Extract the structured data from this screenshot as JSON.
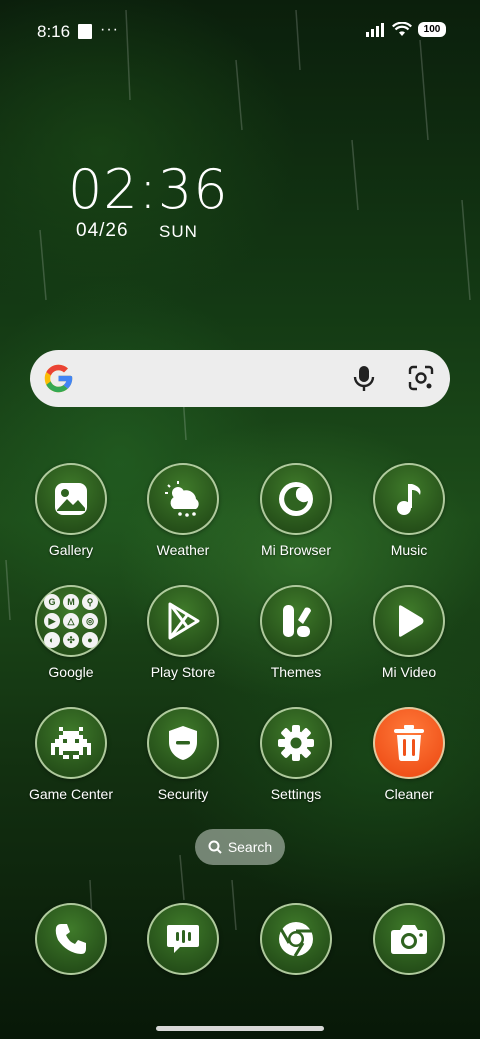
{
  "status_bar": {
    "time": "8:16",
    "dots": "···",
    "battery": "100"
  },
  "clock": {
    "time": "02:36",
    "date": "04/26",
    "day": "SUN"
  },
  "search_widget": {
    "brand": "Google",
    "colors": {
      "blue": "#4285F4",
      "red": "#EA4335",
      "yellow": "#FBBC05",
      "green": "#34A853"
    }
  },
  "apps": [
    {
      "label": "Gallery",
      "icon": "gallery-icon"
    },
    {
      "label": "Weather",
      "icon": "weather-icon"
    },
    {
      "label": "Mi Browser",
      "icon": "browser-icon"
    },
    {
      "label": "Music",
      "icon": "music-icon"
    },
    {
      "label": "Google",
      "icon": "google-folder-icon"
    },
    {
      "label": "Play Store",
      "icon": "play-store-icon"
    },
    {
      "label": "Themes",
      "icon": "themes-icon"
    },
    {
      "label": "Mi Video",
      "icon": "video-icon"
    },
    {
      "label": "Game Center",
      "icon": "game-center-icon"
    },
    {
      "label": "Security",
      "icon": "security-icon"
    },
    {
      "label": "Settings",
      "icon": "settings-icon"
    },
    {
      "label": "Cleaner",
      "icon": "cleaner-icon"
    }
  ],
  "folder_glyphs": [
    "G",
    "M",
    "⚲",
    "▶",
    "△",
    "◎",
    "◐",
    "✣",
    "●"
  ],
  "drawer_search": {
    "label": "Search"
  },
  "dock": [
    {
      "icon": "phone-icon"
    },
    {
      "icon": "messages-icon"
    },
    {
      "icon": "chrome-icon"
    },
    {
      "icon": "camera-icon"
    }
  ],
  "theme": {
    "icon_fill": "#2f6320",
    "icon_border": "#dcf0c8",
    "cleaner": "#f0521a"
  }
}
